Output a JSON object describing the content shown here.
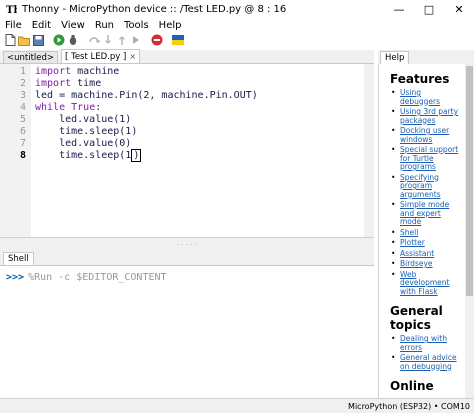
{
  "window": {
    "title": "Thonny  -  MicroPython device :: /Test LED.py  @  8 : 16",
    "minimize": "—",
    "maximize": "□",
    "close": "✕"
  },
  "menu": [
    "File",
    "Edit",
    "View",
    "Run",
    "Tools",
    "Help"
  ],
  "toolbar": {
    "icons": [
      "new-file-icon",
      "open-file-icon",
      "save-icon",
      "run-icon",
      "debug-icon",
      "step-over-icon",
      "step-into-icon",
      "step-out-icon",
      "resume-icon",
      "stop-icon",
      "ukraine-flag-icon"
    ]
  },
  "editor_tabs": [
    {
      "label": "<untitled>",
      "active": false
    },
    {
      "label": "[ Test LED.py ]",
      "active": true,
      "close": "×"
    }
  ],
  "editor": {
    "line_numbers": [
      "1",
      "2",
      "3",
      "4",
      "5",
      "6",
      "7",
      "8"
    ],
    "current_line": 8,
    "lines": [
      {
        "kw": "import",
        "rest": " machine"
      },
      {
        "kw": "import",
        "rest": " time"
      },
      {
        "kw": "",
        "rest": "led = machine.Pin(2, machine.Pin.OUT)"
      },
      {
        "kw": "while",
        "rest": " ",
        "kw2": "True",
        "rest2": ":"
      },
      {
        "kw": "",
        "rest": "    led.value(1)"
      },
      {
        "kw": "",
        "rest": "    time.sleep(1)"
      },
      {
        "kw": "",
        "rest": "    led.value(0)"
      },
      {
        "kw": "",
        "rest": "    time.sleep(1)"
      }
    ]
  },
  "shell": {
    "tab_label": "Shell",
    "prompt": ">>>",
    "command": "%Run -c $EDITOR_CONTENT"
  },
  "help": {
    "tab_label": "Help",
    "sections": [
      {
        "title": "Features",
        "items": [
          "Using debuggers",
          "Using 3rd party packages",
          "Docking user windows",
          "Special support for Turtle programs",
          "Specifying program arguments",
          "Simple mode and expert mode",
          "Shell",
          "Plotter",
          "Assistant",
          "Birdseye",
          "Web development with Flask"
        ]
      },
      {
        "title": "General topics",
        "items": [
          "Dealing with errors",
          "General advice on debugging"
        ]
      },
      {
        "title": "Online",
        "items": []
      }
    ]
  },
  "status": {
    "interpreter": "MicroPython (ESP32)  •  COM10"
  }
}
